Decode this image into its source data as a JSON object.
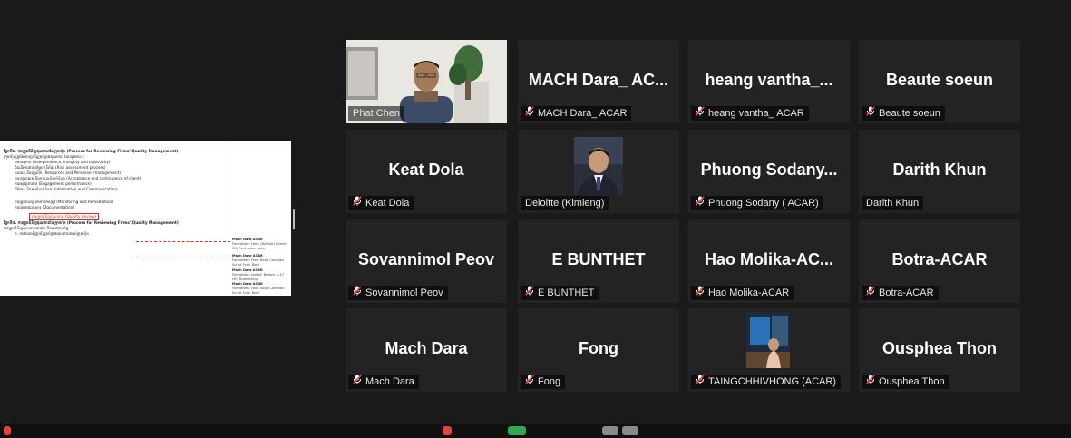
{
  "screen_share": {
    "heading1": "ផ្នែកទី៦. ការត្រួតពិនិត្យគុណភាពនៃក្រុមហ៊ុន (Process for Reviewing Firms' Quality Management)",
    "para1": "ក្រុមហ៊ុនត្រូវតែមានប្រព័ន្ធគ្រប់គ្រងគុណភាព ដែលរួមមាន ៖",
    "items": [
      "ឯករាជ្យភាព (Independence, integrity and objectivity)",
      "ដំណើរការវាយតម្លៃហានិភ័យ (Risk assessment process)",
      "ធនធាន និងបុគ្គលិក (Resources and Personnel management)",
      "ការទទួលយក និងការបន្តទំនាក់ទំនង (Acceptance and continuance of client)",
      "ការអនុវត្តការងារ (Engagement performance)",
      "ព័ត៌មាន និងការទំនាក់ទំនង (Information and Communication)",
      "ការត្រួតពិនិត្យ និងការកែតម្រូវ (Monitoring and Remediation)",
      "ការចងក្រងឯកសារ (Documentation)"
    ],
    "highlight": "ការត្រួតពិនិត្យគុណភាព (Quality Review)",
    "heading2": "ផ្នែកទី៧. ការត្រួតពិនិត្យគុណភាពនៃក្រុមហ៊ុន (Process for Reviewing Firms' Quality Management)",
    "para2": "ការត្រួតពិនិត្យគុណភាពការងារ និងការវាយតម្លៃ",
    "item_last": "ក. ការវាយតម្លៃប្រព័ន្ធគ្រប់គ្រងគុណភាពរបស់ក្រុមហ៊ុន",
    "comments": [
      {
        "author": "Mach Dara ACAR",
        "text": "Formatted: Font: (Default) Khmer OS, Font color: Auto"
      },
      {
        "author": "Mach Dara ACAR",
        "text": "Formatted: Font: Bold, Complex Script Font: Bold"
      },
      {
        "author": "Mach Dara ACAR",
        "text": "Formatted: Indent: Before: 1.27 cm, Numbering"
      },
      {
        "author": "Mach Dara ACAR",
        "text": "Formatted: Font: Bold, Complex Script Font: Bold"
      }
    ]
  },
  "participants": [
    {
      "display": "",
      "label": "Phat Chen",
      "muted": false,
      "video": "phat",
      "active": true
    },
    {
      "display": "MACH Dara_ AC...",
      "label": "MACH Dara_ ACAR",
      "muted": true
    },
    {
      "display": "heang vantha_...",
      "label": "heang vantha_ ACAR",
      "muted": true
    },
    {
      "display": "Beaute soeun",
      "label": "Beaute soeun",
      "muted": true
    },
    {
      "display": "Keat Dola",
      "label": "Keat Dola",
      "muted": true
    },
    {
      "display": "",
      "label": "Deloitte (Kimleng)",
      "muted": false,
      "video": "kimleng"
    },
    {
      "display": "Phuong Sodany...",
      "label": "Phuong Sodany ( ACAR)",
      "muted": true
    },
    {
      "display": "Darith Khun",
      "label": "Darith Khun",
      "muted": false
    },
    {
      "display": "Sovannimol Peov",
      "label": "Sovannimol Peov",
      "muted": true
    },
    {
      "display": "E BUNTHET",
      "label": "E BUNTHET",
      "muted": true
    },
    {
      "display": "Hao Molika-AC...",
      "label": "Hao Molika-ACAR",
      "muted": true
    },
    {
      "display": "Botra-ACAR",
      "label": "Botra-ACAR",
      "muted": true
    },
    {
      "display": "Mach Dara",
      "label": "Mach Dara",
      "muted": true
    },
    {
      "display": "Fong",
      "label": "Fong",
      "muted": true
    },
    {
      "display": "",
      "label": "TAINGCHHIVHONG (ACAR)",
      "muted": true,
      "video": "taing"
    },
    {
      "display": "Ousphea Thon",
      "label": "Ousphea Thon",
      "muted": true
    }
  ],
  "colors": {
    "active_border": "#c8e02c",
    "muted_icon": "#e8433b",
    "tile_bg": "#232323"
  }
}
